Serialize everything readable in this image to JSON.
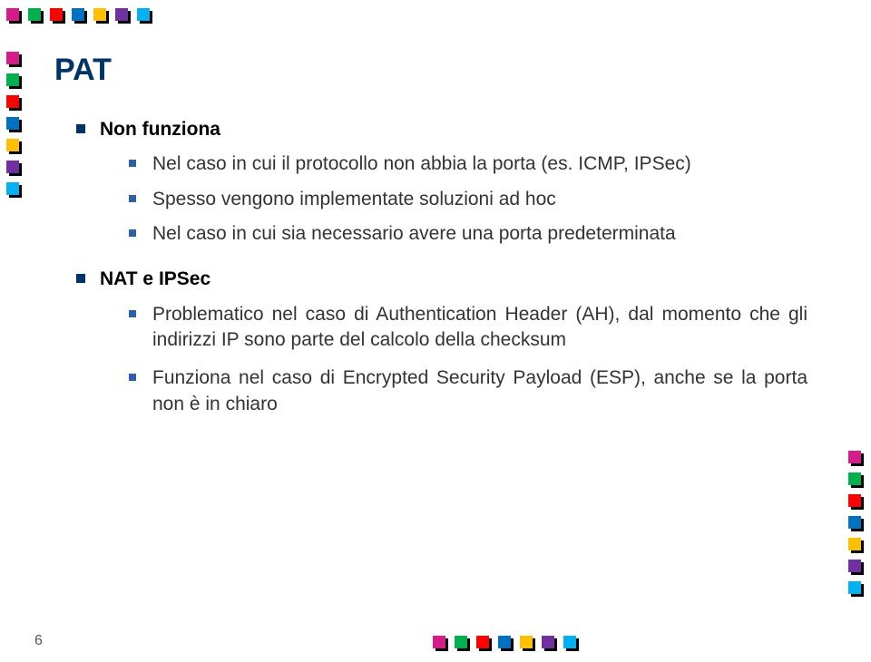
{
  "title": "PAT",
  "bullets": {
    "item1": "Non funziona",
    "item1a": "Nel caso in cui il protocollo non abbia la porta (es. ICMP, IPSec)",
    "item1b": "Spesso vengono implementate soluzioni ad hoc",
    "item1c": "Nel caso in cui sia necessario avere una porta predeterminata",
    "item2": "NAT e IPSec",
    "item2a": "Problematico nel caso di Authentication Header (AH), dal momento che gli indirizzi IP sono parte del calcolo della checksum",
    "item2b": "Funziona nel caso di Encrypted Security Payload (ESP), anche se la porta non è in chiaro"
  },
  "page_number": "6"
}
